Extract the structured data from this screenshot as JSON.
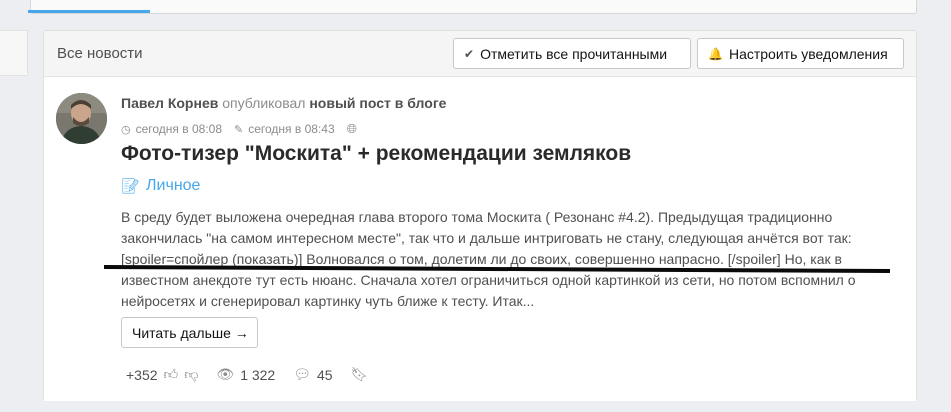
{
  "header": {
    "title": "Все новости",
    "mark_read_label": "Отметить все прочитанными",
    "notify_label": "Настроить уведомления"
  },
  "post": {
    "author": "Павел Корнев",
    "action": "опубликовал",
    "object": "новый пост в блоге",
    "published": "сегодня в 08:08",
    "edited": "сегодня в 08:43",
    "title": "Фото-тизер \"Москита\" + рекомендации земляков",
    "category": "Личное",
    "excerpt": "В среду будет выложена очередная глава второго тома Москита ( Резонанс #4.2). Предыдущая традиционно закончилась \"на самом интересном месте\", так что и дальше интриговать не стану, следующая анчётся вот так: [spoiler=спойлер (показать)] Волновался о том, долетим ли до своих, совершенно напрасно. [/spoiler] Но, как в известном анекдоте тут есть нюанс. Сначала хотел ограничиться одной картинкой из сети, но потом вспомнил о нейросетях и сгенерировал картинку чуть ближе к тесту. Итак...",
    "read_more": "Читать дальше →",
    "rating": "+352",
    "views": "1 322",
    "comments": "45"
  }
}
